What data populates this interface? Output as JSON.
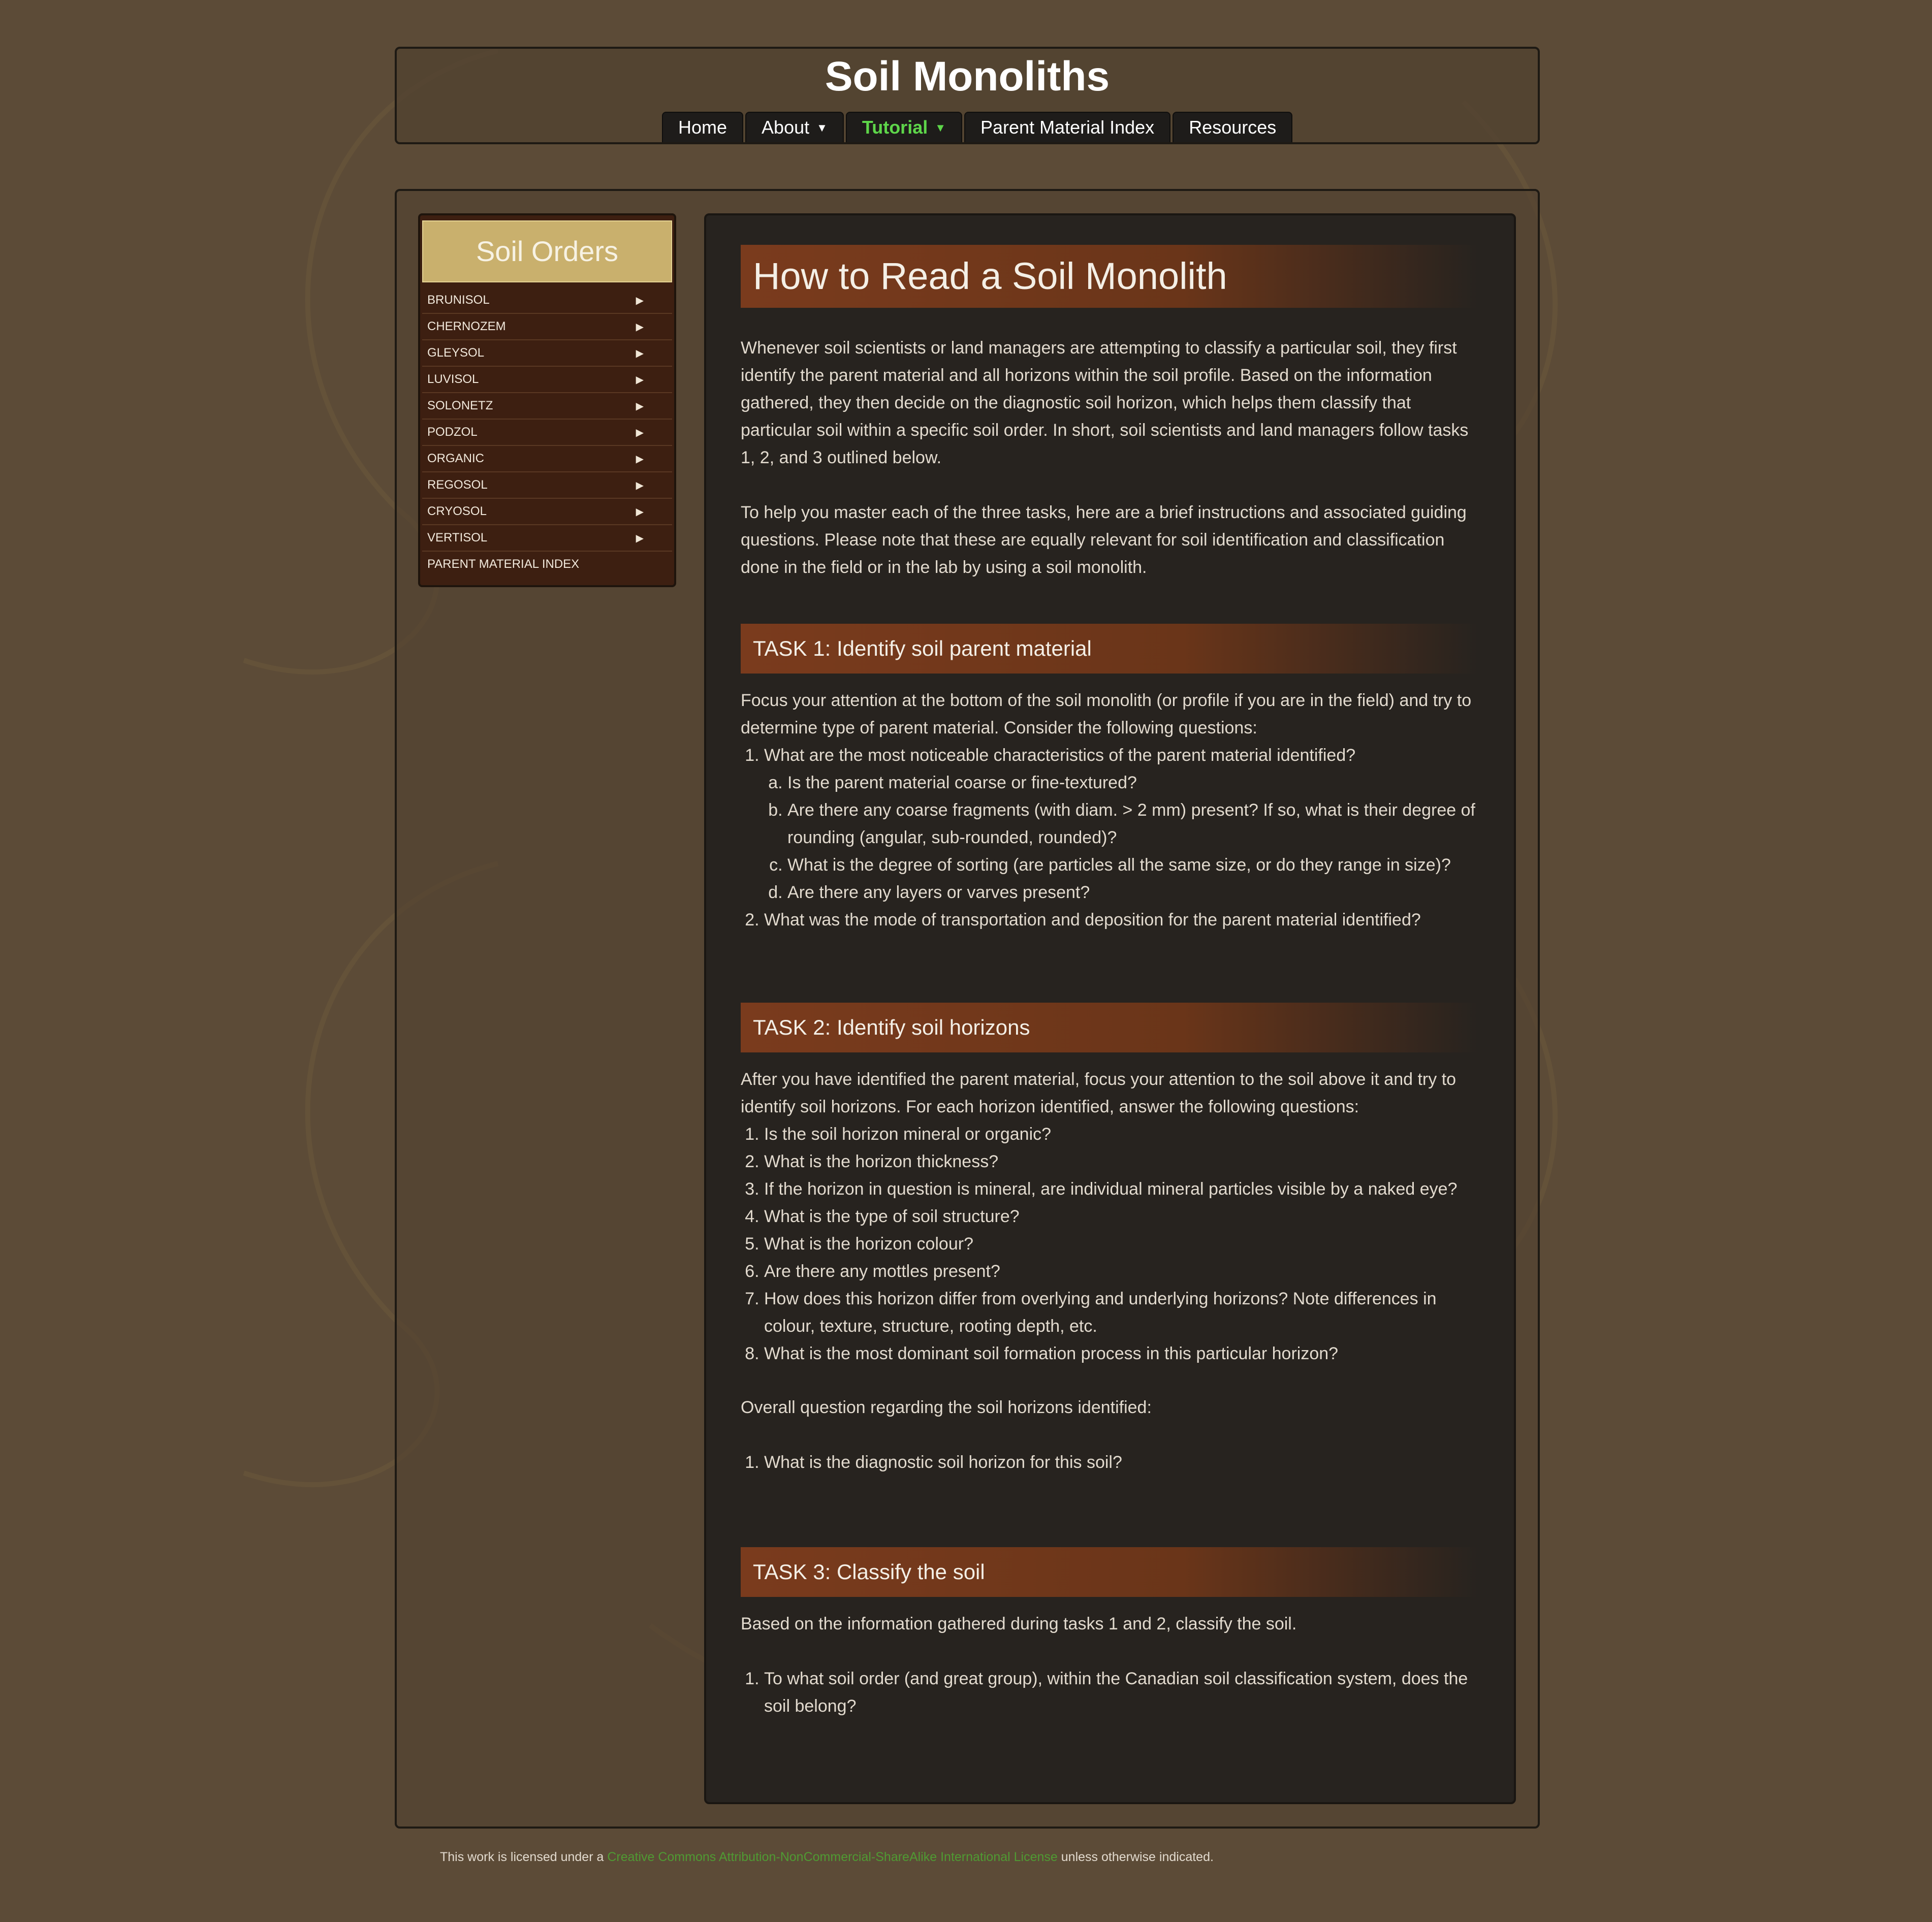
{
  "site": {
    "title": "Soil Monoliths"
  },
  "nav": {
    "items": [
      {
        "label": "Home"
      },
      {
        "label": "About"
      },
      {
        "label": "Tutorial"
      },
      {
        "label": "Parent Material Index"
      },
      {
        "label": "Resources"
      }
    ]
  },
  "sidebar": {
    "title": "Soil Orders",
    "items": [
      {
        "label": "BRUNISOL"
      },
      {
        "label": "CHERNOZEM"
      },
      {
        "label": "GLEYSOL"
      },
      {
        "label": "LUVISOL"
      },
      {
        "label": "SOLONETZ"
      },
      {
        "label": "PODZOL"
      },
      {
        "label": "ORGANIC"
      },
      {
        "label": "REGOSOL"
      },
      {
        "label": "CRYOSOL"
      },
      {
        "label": "VERTISOL"
      },
      {
        "label": "PARENT MATERIAL INDEX"
      }
    ]
  },
  "main": {
    "title": "How to Read a Soil Monolith",
    "intro1": "Whenever soil scientists or land managers are attempting to classify a particular soil, they first identify the parent material and all horizons within the soil profile. Based on the information gathered, they then decide on the diagnostic soil horizon, which helps them classify that particular soil within a specific soil order. In short, soil scientists and land managers follow tasks 1, 2, and 3 outlined below.",
    "intro2": "To help you master each of the three tasks, here are a brief instructions and associated guiding questions. Please note that these are equally relevant for soil identification and classification done in the field or in the lab by using a soil monolith.",
    "task1": {
      "heading": "TASK 1: Identify soil parent material",
      "text": "Focus your attention at the bottom of the soil monolith (or profile if you are in the field) and try to determine type of parent material. Consider the following questions:",
      "q1": "What are the most noticeable characteristics of the parent material identified?",
      "sub": [
        "Is the parent material coarse or fine-textured?",
        "Are there any coarse fragments (with diam. > 2 mm) present? If so, what is their degree of rounding (angular, sub-rounded, rounded)?",
        "What is the degree of sorting (are particles all the same size, or do they range in size)?",
        "Are there any layers or varves present?"
      ],
      "q2": "What was the mode of transportation and deposition for the parent material identified?"
    },
    "task2": {
      "heading": "TASK 2: Identify soil horizons",
      "text": "After you have identified the parent material, focus your attention to the soil above it and try to identify soil horizons. For each horizon identified, answer the following questions:",
      "questions": [
        "Is the soil horizon mineral or organic?",
        "What is the horizon thickness?",
        "If the horizon in question is mineral, are individual mineral particles visible by a naked eye?",
        "What is the type of soil structure?",
        "What is the horizon colour?",
        "Are there any mottles present?",
        "How does this horizon differ from overlying and underlying horizons? Note differences in colour, texture, structure, rooting depth, etc.",
        "What is the most dominant soil formation process in this particular horizon?"
      ],
      "overall": "Overall question regarding the soil horizons identified:",
      "overall_q": "What is the diagnostic soil horizon for this soil?"
    },
    "task3": {
      "heading": "TASK 3: Classify the soil",
      "text": "Based on the information gathered during tasks 1 and 2, classify the soil.",
      "q1": "To what soil order (and great group), within the Canadian soil classification system, does the soil belong?"
    }
  },
  "footer": {
    "prefix": "This work is licensed under a ",
    "link": "Creative Commons Attribution-NonCommercial-ShareAlike International License",
    "suffix": " unless otherwise indicated."
  },
  "colors": {
    "background": "#5c4b37",
    "nav_active": "#5ed64a",
    "heading_bar": "#7a3b1d",
    "sidebar_head": "#c9b06d",
    "footer_link": "#4f9a33"
  }
}
